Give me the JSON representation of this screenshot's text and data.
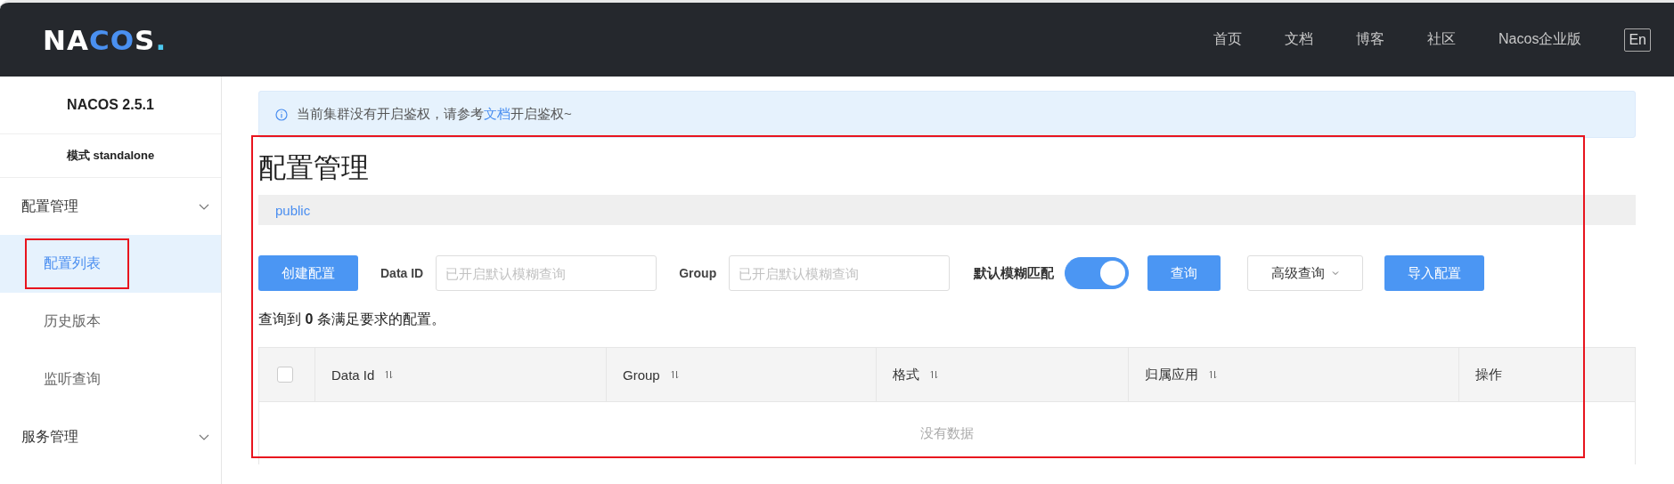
{
  "header": {
    "logo": "NACOS.",
    "nav": [
      "首页",
      "文档",
      "博客",
      "社区",
      "Nacos企业版"
    ],
    "language": "En"
  },
  "sidebar": {
    "version": "NACOS 2.5.1",
    "mode": "模式 standalone",
    "groups": [
      {
        "label": "配置管理",
        "children": [
          {
            "label": "配置列表",
            "selected": true
          },
          {
            "label": "历史版本",
            "selected": false
          },
          {
            "label": "监听查询",
            "selected": false
          }
        ]
      },
      {
        "label": "服务管理"
      }
    ]
  },
  "notice": {
    "before": "当前集群没有开启鉴权，请参考",
    "link": "文档",
    "after": "开启鉴权~"
  },
  "title": "配置管理",
  "namespace": "public",
  "toolbar": {
    "create_button": "创建配置",
    "data_id_label": "Data ID",
    "data_id_placeholder": "已开启默认模糊查询",
    "group_label": "Group",
    "group_placeholder": "已开启默认模糊查询",
    "fuzzy_label": "默认模糊匹配",
    "fuzzy_on": true,
    "search_button": "查询",
    "advanced_button": "高级查询",
    "import_button": "导入配置"
  },
  "result": "查询到 **0** 条满足要求的配置。",
  "table": {
    "select_all": false,
    "columns": [
      {
        "label": "Data Id",
        "sortable": true
      },
      {
        "label": "Group",
        "sortable": true
      },
      {
        "label": "格式",
        "sortable": true
      },
      {
        "label": "归属应用",
        "sortable": true
      },
      {
        "label": "操作",
        "sortable": false
      }
    ],
    "empty": "没有数据"
  }
}
